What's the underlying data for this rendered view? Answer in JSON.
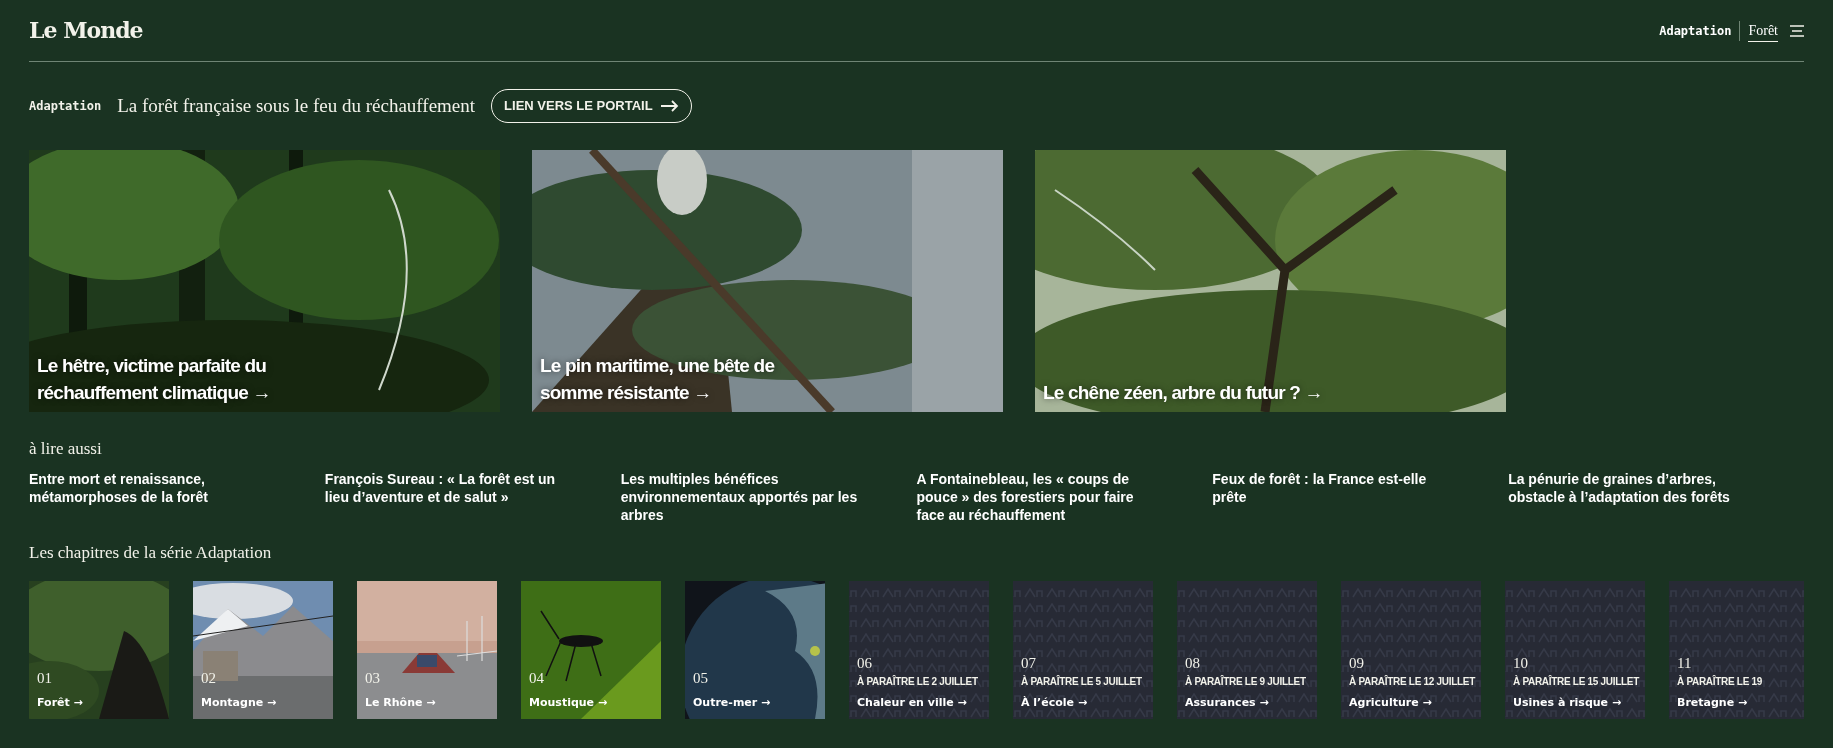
{
  "header": {
    "logo": "Le Monde",
    "nav": [
      {
        "label": "Adaptation",
        "selected": false
      },
      {
        "label": "Forêt",
        "selected": true
      }
    ]
  },
  "banner": {
    "tag": "Adaptation",
    "title": "La forêt française sous le feu du réchauffement",
    "button": "LIEN VERS LE PORTAIL"
  },
  "articles": [
    {
      "title": "Le hêtre, victime parfaite du réchauffement climatique →"
    },
    {
      "title": "Le pin maritime, une bête de somme résistante →"
    },
    {
      "title": "Le chêne zéen, arbre du futur ? →"
    }
  ],
  "read_also": {
    "heading": "à lire aussi",
    "links": [
      "Entre mort et renaissance, métamorphoses de la forêt",
      "François Sureau : « La forêt est un lieu d’aventure et de salut »",
      "Les multiples bénéfices environnementaux apportés par les arbres",
      "A Fontainebleau, les « coups de pouce » des forestiers pour faire face au réchauffement",
      "Feux de forêt : la France est-elle prête",
      "La pénurie de graines d’arbres, obstacle à l’adaptation des forêts"
    ]
  },
  "chapters": {
    "heading": "Les chapitres de la série Adaptation",
    "items": [
      {
        "number": "01",
        "name": "Forêt →"
      },
      {
        "number": "02",
        "name": "Montagne →"
      },
      {
        "number": "03",
        "name": "Le Rhône →"
      },
      {
        "number": "04",
        "name": "Moustique →"
      },
      {
        "number": "05",
        "name": "Outre-mer →"
      },
      {
        "kind": "upcoming",
        "number": "06",
        "release": "À PARAÎTRE LE 2 JUILLET",
        "name": "Chaleur en ville →"
      },
      {
        "kind": "upcoming",
        "number": "07",
        "release": "À PARAÎTRE LE 5 JUILLET",
        "name": "À l’école →"
      },
      {
        "kind": "upcoming",
        "number": "08",
        "release": "À PARAÎTRE LE 9 JUILLET",
        "name": "Assurances →"
      },
      {
        "kind": "upcoming",
        "number": "09",
        "release": "À PARAÎTRE LE 12 JUILLET",
        "name": "Agriculture →"
      },
      {
        "kind": "upcoming",
        "number": "10",
        "release": "À PARAÎTRE LE 15 JUILLET",
        "name": "Usines à risque →"
      },
      {
        "kind": "upcoming",
        "number": "11",
        "release": "À PARAÎTRE LE 19",
        "name": "Bretagne →"
      }
    ]
  }
}
